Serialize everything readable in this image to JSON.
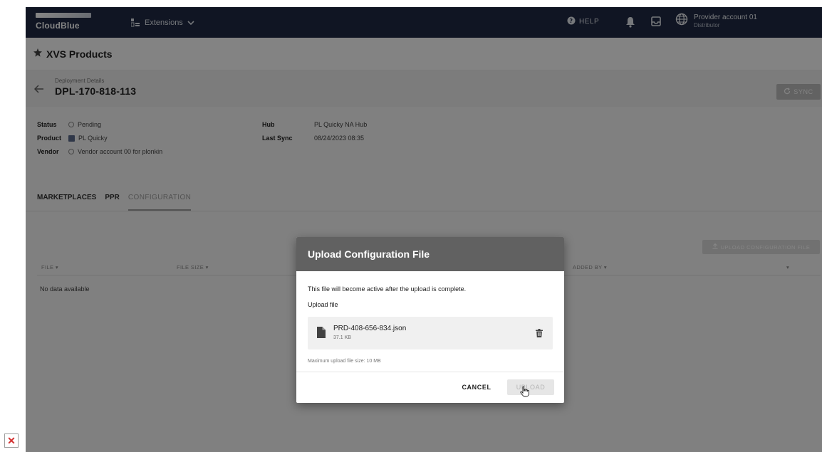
{
  "topbar": {
    "logo_text": "CloudBlue",
    "extensions_label": "Extensions",
    "help_label": "HELP",
    "account_name": "Provider account 01",
    "account_role": "Distributor"
  },
  "page": {
    "title": "XVS Products"
  },
  "deployment": {
    "label": "Deployment Details",
    "id": "DPL-170-818-113",
    "sync_label": "SYNC"
  },
  "info": {
    "status_label": "Status",
    "status_value": "Pending",
    "product_label": "Product",
    "product_value": "PL Quicky",
    "vendor_label": "Vendor",
    "vendor_value": "Vendor account 00 for plonkin",
    "hub_label": "Hub",
    "hub_value": "PL Quicky NA Hub",
    "last_sync_label": "Last Sync",
    "last_sync_value": "08/24/2023 08:35"
  },
  "tabs": {
    "marketplaces": "MARKETPLACES",
    "ppr": "PPR",
    "configuration": "CONFIGURATION"
  },
  "table": {
    "upload_button": "UPLOAD CONFIGURATION FILE",
    "col_file": "FILE",
    "col_size": "FILE SIZE",
    "col_added_by": "ADDED BY",
    "empty": "No data available"
  },
  "dialog": {
    "title": "Upload Configuration File",
    "description": "This file will become active after the upload is complete.",
    "upload_label": "Upload file",
    "file_name": "PRD-408-656-834.json",
    "file_size": "37.1 KB",
    "max_size": "Maximum upload file size: 10 MB",
    "cancel": "CANCEL",
    "upload": "UPLOAD"
  },
  "icons": {
    "extensions": "extensions-icon",
    "chevron": "chevron-down-icon",
    "help": "help-icon",
    "bell": "bell-icon",
    "inbox": "inbox-icon",
    "globe": "globe-icon",
    "pin": "pin-icon",
    "back": "arrow-left-icon",
    "sync": "sync-icon",
    "file": "file-icon",
    "trash": "trash-icon",
    "cursor": "hand-cursor-icon",
    "broken": "broken-image-icon"
  },
  "broken_glyph": "✕"
}
